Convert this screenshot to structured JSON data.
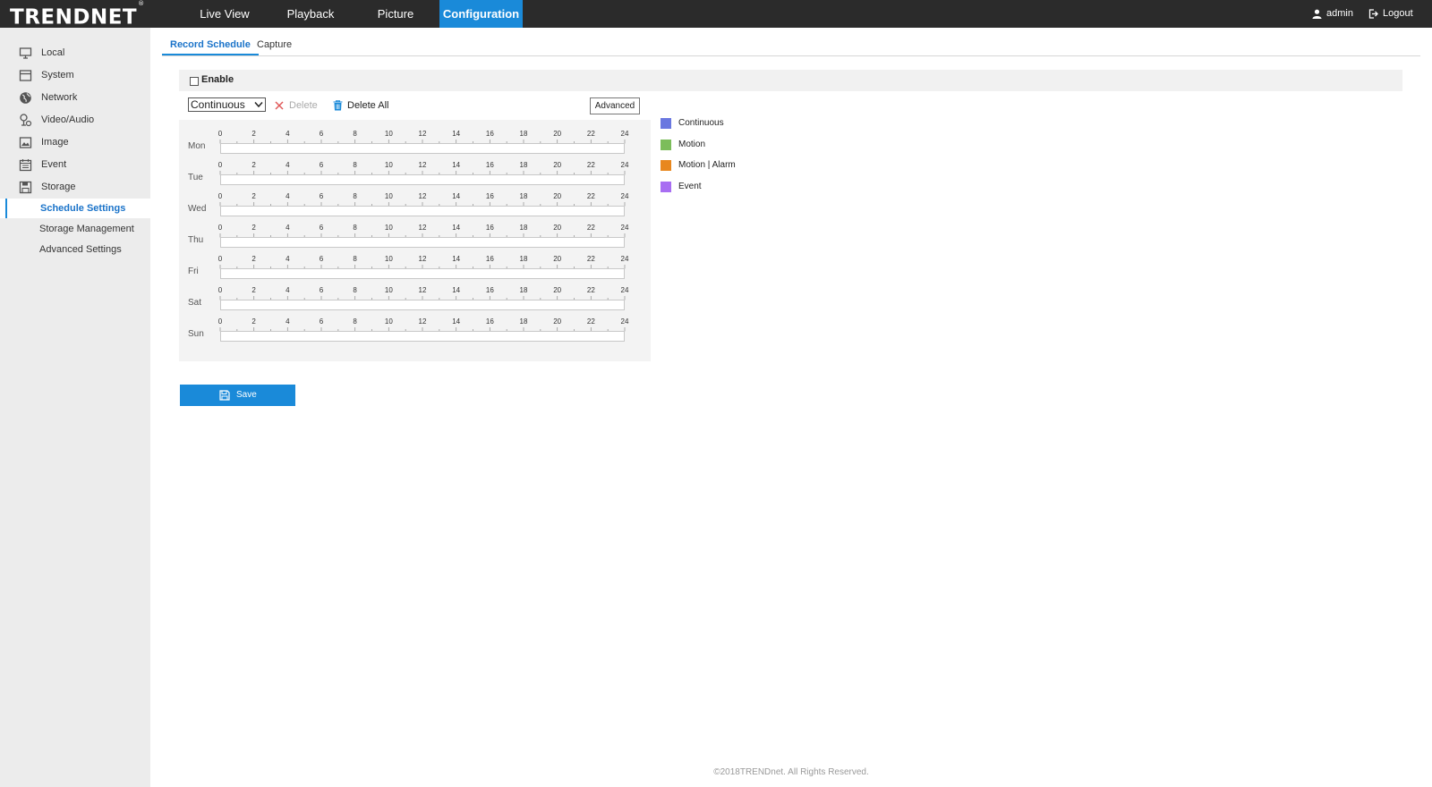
{
  "brand": {
    "name": "TRENDNET",
    "mark": "®"
  },
  "nav": {
    "tabs": [
      {
        "label": "Live View"
      },
      {
        "label": "Playback"
      },
      {
        "label": "Picture"
      },
      {
        "label": "Configuration",
        "active": true
      }
    ],
    "user": "admin",
    "logout": "Logout"
  },
  "sidebar": {
    "items": [
      {
        "label": "Local",
        "icon": "monitor-icon"
      },
      {
        "label": "System",
        "icon": "system-icon"
      },
      {
        "label": "Network",
        "icon": "globe-icon"
      },
      {
        "label": "Video/Audio",
        "icon": "video-audio-icon"
      },
      {
        "label": "Image",
        "icon": "image-icon"
      },
      {
        "label": "Event",
        "icon": "calendar-icon"
      },
      {
        "label": "Storage",
        "icon": "storage-icon"
      }
    ],
    "subitems": [
      {
        "label": "Schedule Settings",
        "active": true
      },
      {
        "label": "Storage Management"
      },
      {
        "label": "Advanced Settings"
      }
    ]
  },
  "subtabs": [
    {
      "label": "Record Schedule",
      "active": true
    },
    {
      "label": "Capture"
    }
  ],
  "enable": {
    "label": "Enable",
    "checked": false
  },
  "toolbar": {
    "record_type": "Continuous",
    "delete_label": "Delete",
    "delete_all_label": "Delete All",
    "advanced_label": "Advanced"
  },
  "schedule": {
    "days": [
      "Mon",
      "Tue",
      "Wed",
      "Thu",
      "Fri",
      "Sat",
      "Sun"
    ],
    "hour_ticks": [
      "0",
      "2",
      "4",
      "6",
      "8",
      "10",
      "12",
      "14",
      "16",
      "18",
      "20",
      "22",
      "24"
    ]
  },
  "legend": [
    {
      "label": "Continuous",
      "color": "#6a78e0"
    },
    {
      "label": "Motion",
      "color": "#7cbd5a"
    },
    {
      "label": "Motion | Alarm",
      "color": "#e8871e"
    },
    {
      "label": "Event",
      "color": "#a86ef2"
    }
  ],
  "save_label": "Save",
  "footer": "©2018TRENDnet. All Rights Reserved.",
  "colors": {
    "accent": "#1a8ad9",
    "topbar": "#2b2b2b"
  }
}
